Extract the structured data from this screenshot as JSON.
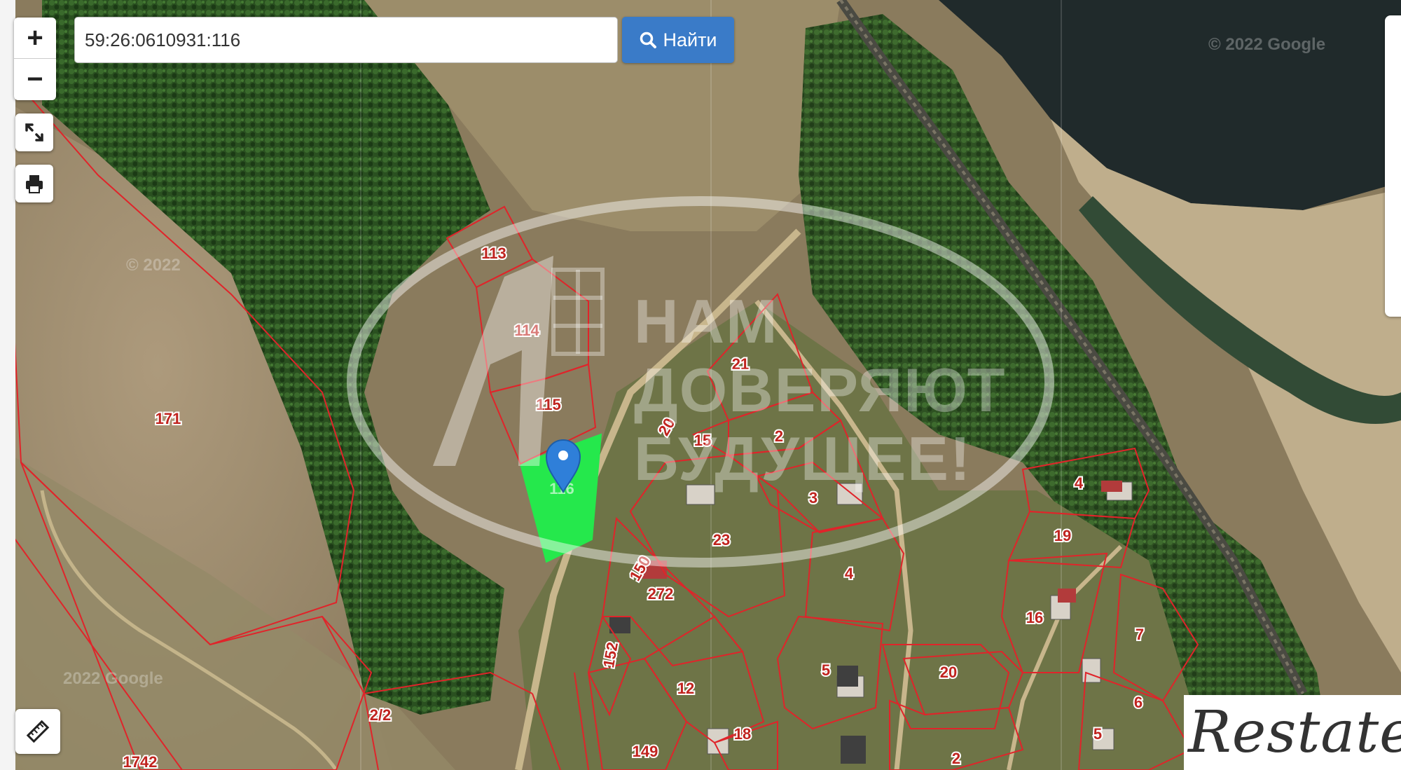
{
  "search": {
    "value": "59:26:0610931:116"
  },
  "find_button": {
    "label": "Найти",
    "icon": "search-icon"
  },
  "controls": {
    "zoom_in": "+",
    "zoom_out": "−",
    "fullscreen_icon": "expand-icon",
    "print_icon": "print-icon",
    "ruler_icon": "ruler-icon"
  },
  "watermark": {
    "lines": [
      "НАМ",
      "ДОВЕРЯЮТ",
      "БУДУЩЕЕ!"
    ]
  },
  "copyrights": [
    "© 2022 Google",
    "© 2022",
    "2022 Google"
  ],
  "branding": {
    "restate": "Restate"
  },
  "colors": {
    "parcel_border": "#e0242a",
    "selected_parcel": "#25e84c",
    "marker": "#2f7fd9",
    "button": "#3a7bc8",
    "label_text": "#c0241f"
  },
  "parcels": [
    {
      "label": "113",
      "selected": false
    },
    {
      "label": "114",
      "selected": false
    },
    {
      "label": "115",
      "selected": false
    },
    {
      "label": "116",
      "selected": true
    },
    {
      "label": "171",
      "selected": false
    },
    {
      "label": "21",
      "selected": false
    },
    {
      "label": "20",
      "selected": false
    },
    {
      "label": "15",
      "selected": false
    },
    {
      "label": "2",
      "selected": false
    },
    {
      "label": "3",
      "selected": false
    },
    {
      "label": "23",
      "selected": false
    },
    {
      "label": "150",
      "selected": false
    },
    {
      "label": "272",
      "selected": false
    },
    {
      "label": "4",
      "selected": false
    },
    {
      "label": "4",
      "selected": false
    },
    {
      "label": "19",
      "selected": false
    },
    {
      "label": "16",
      "selected": false
    },
    {
      "label": "7",
      "selected": false
    },
    {
      "label": "152",
      "selected": false
    },
    {
      "label": "5",
      "selected": false
    },
    {
      "label": "20",
      "selected": false
    },
    {
      "label": "6",
      "selected": false
    },
    {
      "label": "5",
      "selected": false
    },
    {
      "label": "12",
      "selected": false
    },
    {
      "label": "18",
      "selected": false
    },
    {
      "label": "149",
      "selected": false
    },
    {
      "label": "2",
      "selected": false
    },
    {
      "label": "2/2",
      "selected": false
    },
    {
      "label": "1742",
      "selected": false
    }
  ]
}
